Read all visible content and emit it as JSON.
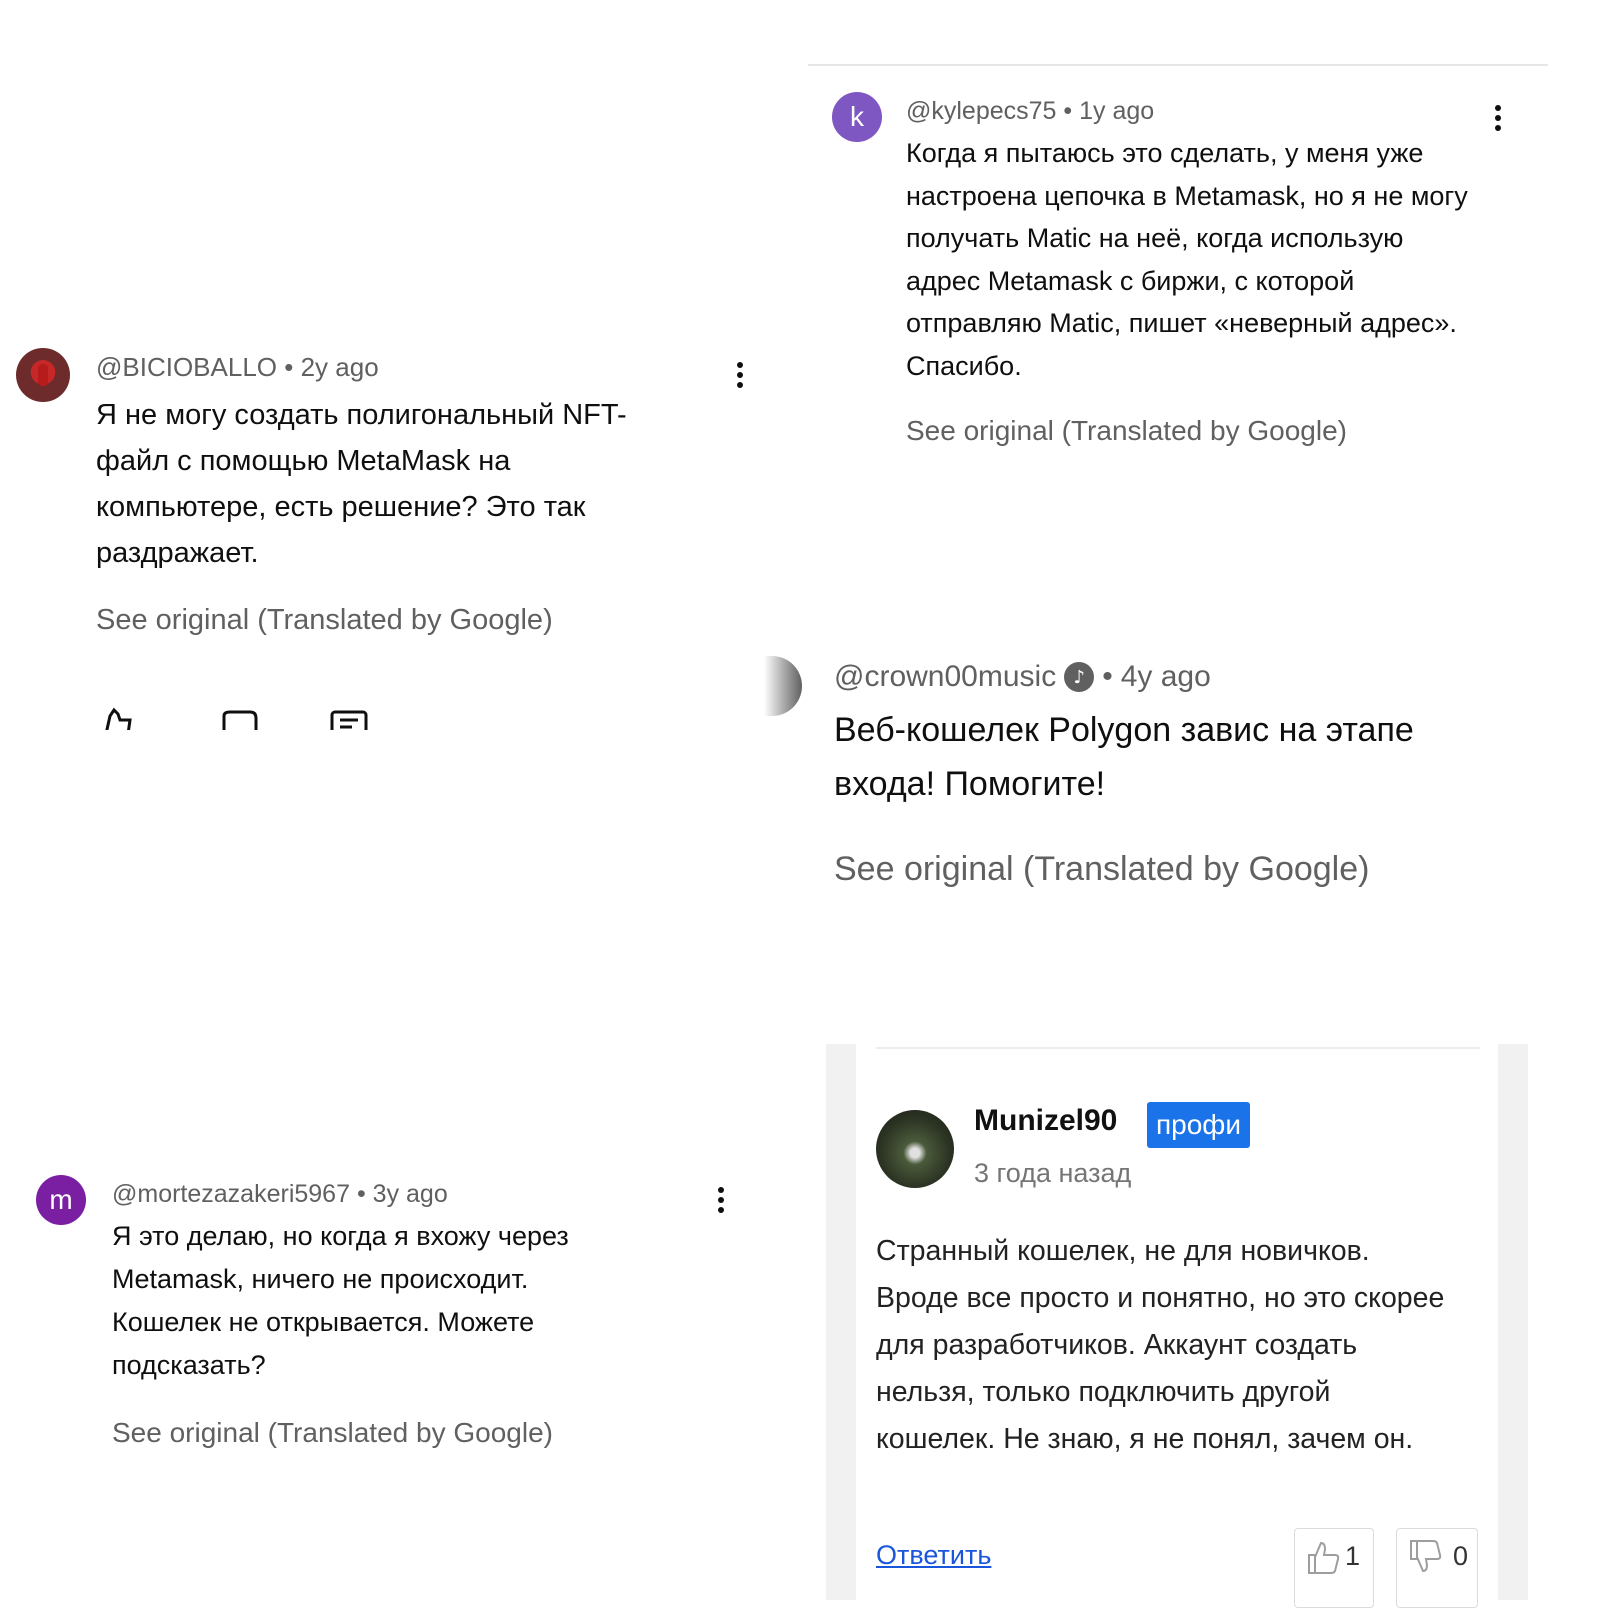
{
  "comments": {
    "bicio": {
      "avatar_letter": "",
      "author": "@BICIOBALLO",
      "separator": "•",
      "time": "2y ago",
      "text": "Я не могу создать полигональный NFT-файл с помощью MetaMask на компьютере, есть решение? Это так раздражает.",
      "see_original": "See original (Translated by Google)"
    },
    "kyle": {
      "avatar_letter": "k",
      "author": "@kylepecs75",
      "separator": "•",
      "time": "1y ago",
      "text": "Когда я пытаюсь это сделать, у меня уже настроена цепочка в Metamask, но я не могу получать Matic на неё, когда использую адрес Metamask с биржи, с которой отправляю Matic, пишет «неверный адрес». Спасибо.",
      "see_original": "See original (Translated by Google)"
    },
    "crown": {
      "author": "@crown00music",
      "separator": "•",
      "time": "4y ago",
      "text": "Веб-кошелек Polygon завис на этапе входа! Помогите!",
      "see_original": "See original (Translated by Google)"
    },
    "morteza": {
      "avatar_letter": "m",
      "author": "@mortezazakeri5967",
      "separator": "•",
      "time": "3y ago",
      "text": "Я это делаю, но когда я вхожу через Metamask, ничего не происходит. Кошелек не открывается. Можете подсказать?",
      "see_original": "See original (Translated by Google)"
    },
    "munizel": {
      "author": "Munizel90",
      "badge": "профи",
      "time": "3 года назад",
      "text": "Странный кошелек, не для новичков. Вроде все просто и понятно, но это скорее для разработчиков. Аккаунт создать нельзя, только подключить другой кошелек. Не знаю, я не понял, зачем он.",
      "reply_label": "Ответить",
      "likes": "1",
      "dislikes": "0"
    }
  },
  "colors": {
    "kyle_avatar": "#7e57c2",
    "morteza_avatar": "#7b1fa2",
    "badge_bg": "#1a73e8",
    "link": "#1a56db"
  }
}
